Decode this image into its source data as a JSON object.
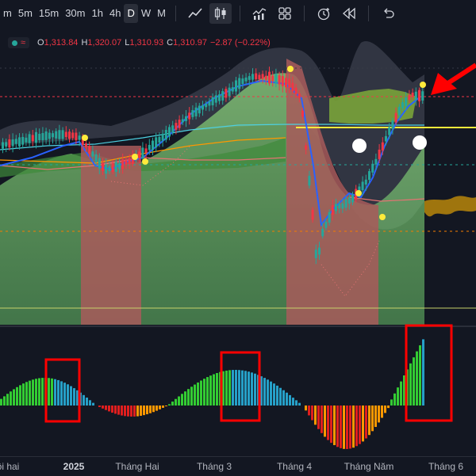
{
  "toolbar": {
    "timeframes": [
      "m",
      "5m",
      "15m",
      "30m",
      "1h",
      "4h",
      "D",
      "W",
      "M"
    ],
    "active_timeframe": "D",
    "tools": [
      "line-chart-icon",
      "candles-icon",
      "indicators-icon",
      "layout-icon",
      "alert-icon",
      "replay-icon",
      "undo-icon"
    ]
  },
  "legend": {
    "wave": "≈",
    "open_key": "O",
    "open": "1,313.84",
    "high_key": "H",
    "high": "1,320.07",
    "low_key": "L",
    "low": "1,310.93",
    "close_key": "C",
    "close": "1,310.97",
    "change": "−2.87 (−0.22%)"
  },
  "time_axis": [
    "ội hai",
    "2025",
    "Tháng Hai",
    "Tháng 3",
    "Tháng 4",
    "Tháng Năm",
    "Tháng 6"
  ],
  "colors": {
    "background": "#131722",
    "up": "#26a69a",
    "down": "#f23645",
    "highlight": "#ff0000",
    "marker": "#ffeb3b"
  }
}
